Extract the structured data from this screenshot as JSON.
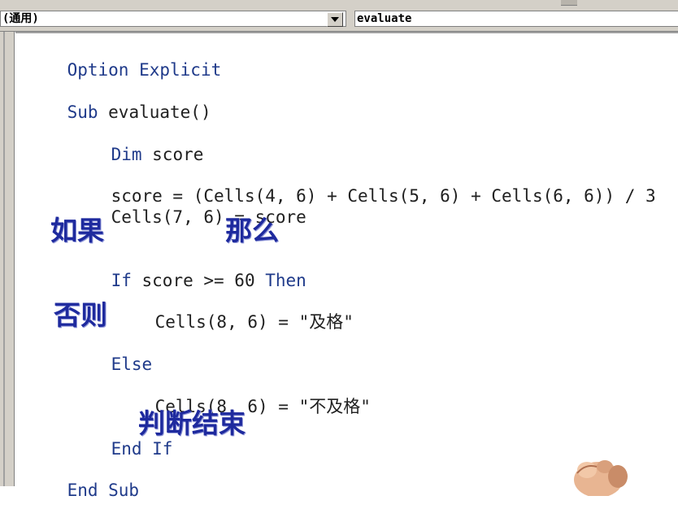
{
  "window": {
    "object_selector": "(通用)",
    "procedure_selector": "evaluate"
  },
  "code": {
    "l1": {
      "kw": "Option Explicit"
    },
    "l2": {
      "kw": "Sub",
      "rest": " evaluate()"
    },
    "l3": {
      "kw": "Dim",
      "rest": " score"
    },
    "l4": {
      "text": "score = (Cells(4, 6) + Cells(5, 6) + Cells(6, 6)) / 3"
    },
    "l5": {
      "text": "Cells(7, 6) = score"
    },
    "l6": {
      "kw1": "If",
      "mid": " score >= 60 ",
      "kw2": "Then"
    },
    "l7": {
      "text": "Cells(8, 6) = \"及格\""
    },
    "l8": {
      "kw": "Else"
    },
    "l9": {
      "text": "Cells(8, 6) = \"不及格\""
    },
    "l10": {
      "kw": "End If"
    },
    "l11": {
      "kw": "End Sub"
    }
  },
  "annotations": {
    "if_label": "如果",
    "then_label": "那么",
    "else_label": "否则",
    "endif_label": "判断结束"
  },
  "colors": {
    "keyword": "#1f3a8a",
    "annotation": "#1e2a9e",
    "frame": "#d4d0c8"
  }
}
